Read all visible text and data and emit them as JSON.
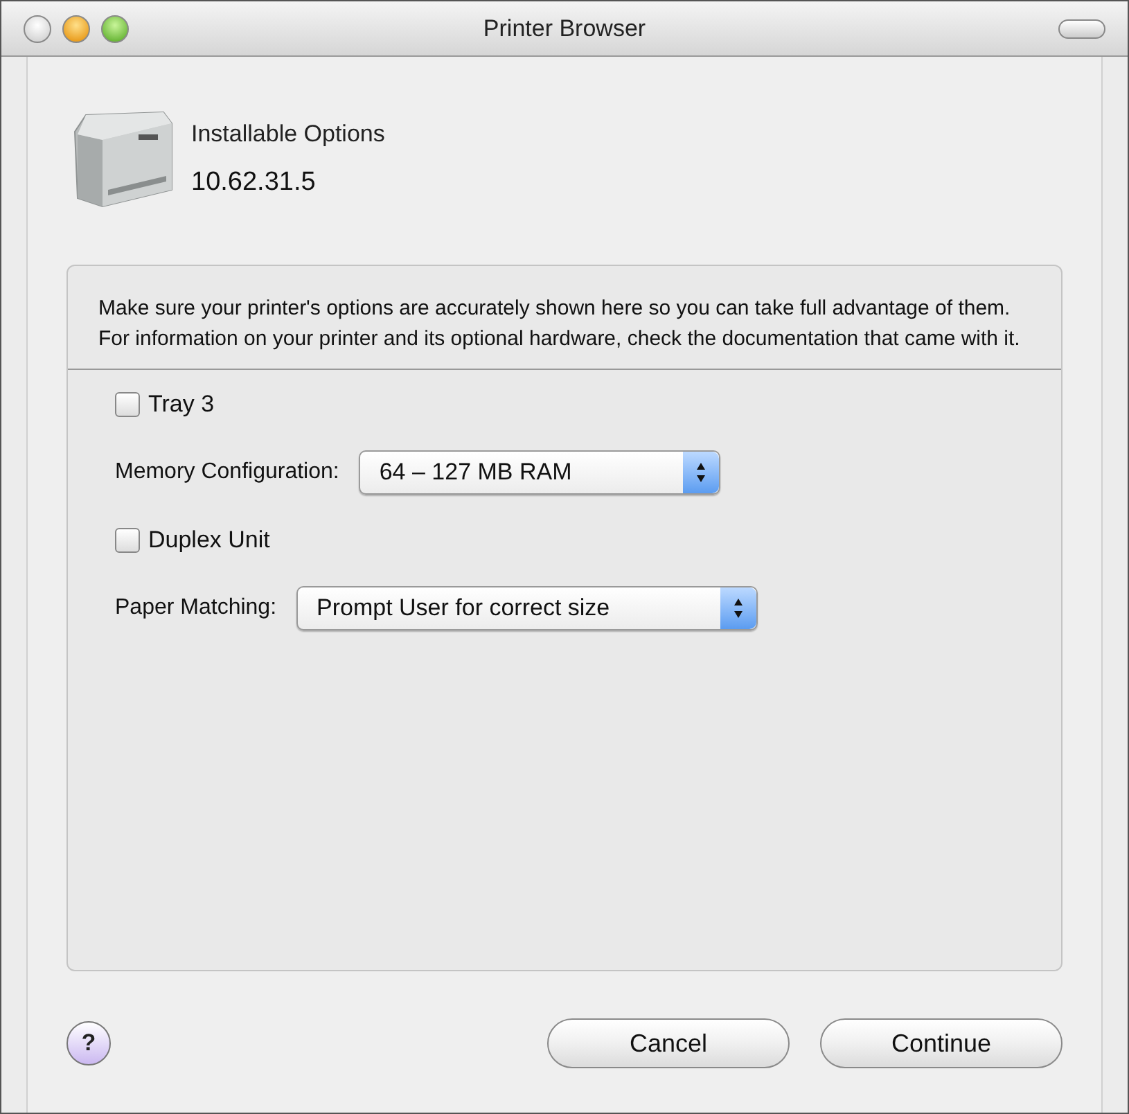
{
  "window": {
    "title": "Printer Browser"
  },
  "header": {
    "title": "Installable Options",
    "address": "10.62.31.5"
  },
  "description": "Make sure your printer's options are accurately shown here so you can take full advantage of them.  For information on your printer and its optional hardware, check the documentation that came with it.",
  "options": [
    {
      "kind": "checkbox",
      "label": "Tray 3",
      "checked": false
    },
    {
      "kind": "popup",
      "label": "Memory Configuration:",
      "value": "64 – 127 MB RAM"
    },
    {
      "kind": "checkbox",
      "label": "Duplex Unit",
      "checked": false
    },
    {
      "kind": "popup",
      "label": "Paper Matching:",
      "value": "Prompt User for correct size"
    }
  ],
  "help_button": "?",
  "buttons": [
    "Cancel",
    "Continue"
  ]
}
